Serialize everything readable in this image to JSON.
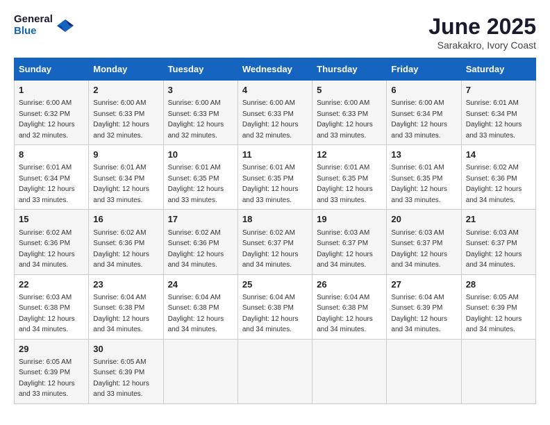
{
  "header": {
    "logo_general": "General",
    "logo_blue": "Blue",
    "month_year": "June 2025",
    "location": "Sarakakro, Ivory Coast"
  },
  "days_of_week": [
    "Sunday",
    "Monday",
    "Tuesday",
    "Wednesday",
    "Thursday",
    "Friday",
    "Saturday"
  ],
  "weeks": [
    [
      {
        "num": "1",
        "sunrise": "6:00 AM",
        "sunset": "6:32 PM",
        "daylight": "12 hours and 32 minutes."
      },
      {
        "num": "2",
        "sunrise": "6:00 AM",
        "sunset": "6:33 PM",
        "daylight": "12 hours and 32 minutes."
      },
      {
        "num": "3",
        "sunrise": "6:00 AM",
        "sunset": "6:33 PM",
        "daylight": "12 hours and 32 minutes."
      },
      {
        "num": "4",
        "sunrise": "6:00 AM",
        "sunset": "6:33 PM",
        "daylight": "12 hours and 32 minutes."
      },
      {
        "num": "5",
        "sunrise": "6:00 AM",
        "sunset": "6:33 PM",
        "daylight": "12 hours and 33 minutes."
      },
      {
        "num": "6",
        "sunrise": "6:00 AM",
        "sunset": "6:34 PM",
        "daylight": "12 hours and 33 minutes."
      },
      {
        "num": "7",
        "sunrise": "6:01 AM",
        "sunset": "6:34 PM",
        "daylight": "12 hours and 33 minutes."
      }
    ],
    [
      {
        "num": "8",
        "sunrise": "6:01 AM",
        "sunset": "6:34 PM",
        "daylight": "12 hours and 33 minutes."
      },
      {
        "num": "9",
        "sunrise": "6:01 AM",
        "sunset": "6:34 PM",
        "daylight": "12 hours and 33 minutes."
      },
      {
        "num": "10",
        "sunrise": "6:01 AM",
        "sunset": "6:35 PM",
        "daylight": "12 hours and 33 minutes."
      },
      {
        "num": "11",
        "sunrise": "6:01 AM",
        "sunset": "6:35 PM",
        "daylight": "12 hours and 33 minutes."
      },
      {
        "num": "12",
        "sunrise": "6:01 AM",
        "sunset": "6:35 PM",
        "daylight": "12 hours and 33 minutes."
      },
      {
        "num": "13",
        "sunrise": "6:01 AM",
        "sunset": "6:35 PM",
        "daylight": "12 hours and 33 minutes."
      },
      {
        "num": "14",
        "sunrise": "6:02 AM",
        "sunset": "6:36 PM",
        "daylight": "12 hours and 34 minutes."
      }
    ],
    [
      {
        "num": "15",
        "sunrise": "6:02 AM",
        "sunset": "6:36 PM",
        "daylight": "12 hours and 34 minutes."
      },
      {
        "num": "16",
        "sunrise": "6:02 AM",
        "sunset": "6:36 PM",
        "daylight": "12 hours and 34 minutes."
      },
      {
        "num": "17",
        "sunrise": "6:02 AM",
        "sunset": "6:36 PM",
        "daylight": "12 hours and 34 minutes."
      },
      {
        "num": "18",
        "sunrise": "6:02 AM",
        "sunset": "6:37 PM",
        "daylight": "12 hours and 34 minutes."
      },
      {
        "num": "19",
        "sunrise": "6:03 AM",
        "sunset": "6:37 PM",
        "daylight": "12 hours and 34 minutes."
      },
      {
        "num": "20",
        "sunrise": "6:03 AM",
        "sunset": "6:37 PM",
        "daylight": "12 hours and 34 minutes."
      },
      {
        "num": "21",
        "sunrise": "6:03 AM",
        "sunset": "6:37 PM",
        "daylight": "12 hours and 34 minutes."
      }
    ],
    [
      {
        "num": "22",
        "sunrise": "6:03 AM",
        "sunset": "6:38 PM",
        "daylight": "12 hours and 34 minutes."
      },
      {
        "num": "23",
        "sunrise": "6:04 AM",
        "sunset": "6:38 PM",
        "daylight": "12 hours and 34 minutes."
      },
      {
        "num": "24",
        "sunrise": "6:04 AM",
        "sunset": "6:38 PM",
        "daylight": "12 hours and 34 minutes."
      },
      {
        "num": "25",
        "sunrise": "6:04 AM",
        "sunset": "6:38 PM",
        "daylight": "12 hours and 34 minutes."
      },
      {
        "num": "26",
        "sunrise": "6:04 AM",
        "sunset": "6:38 PM",
        "daylight": "12 hours and 34 minutes."
      },
      {
        "num": "27",
        "sunrise": "6:04 AM",
        "sunset": "6:39 PM",
        "daylight": "12 hours and 34 minutes."
      },
      {
        "num": "28",
        "sunrise": "6:05 AM",
        "sunset": "6:39 PM",
        "daylight": "12 hours and 34 minutes."
      }
    ],
    [
      {
        "num": "29",
        "sunrise": "6:05 AM",
        "sunset": "6:39 PM",
        "daylight": "12 hours and 33 minutes."
      },
      {
        "num": "30",
        "sunrise": "6:05 AM",
        "sunset": "6:39 PM",
        "daylight": "12 hours and 33 minutes."
      },
      null,
      null,
      null,
      null,
      null
    ]
  ]
}
